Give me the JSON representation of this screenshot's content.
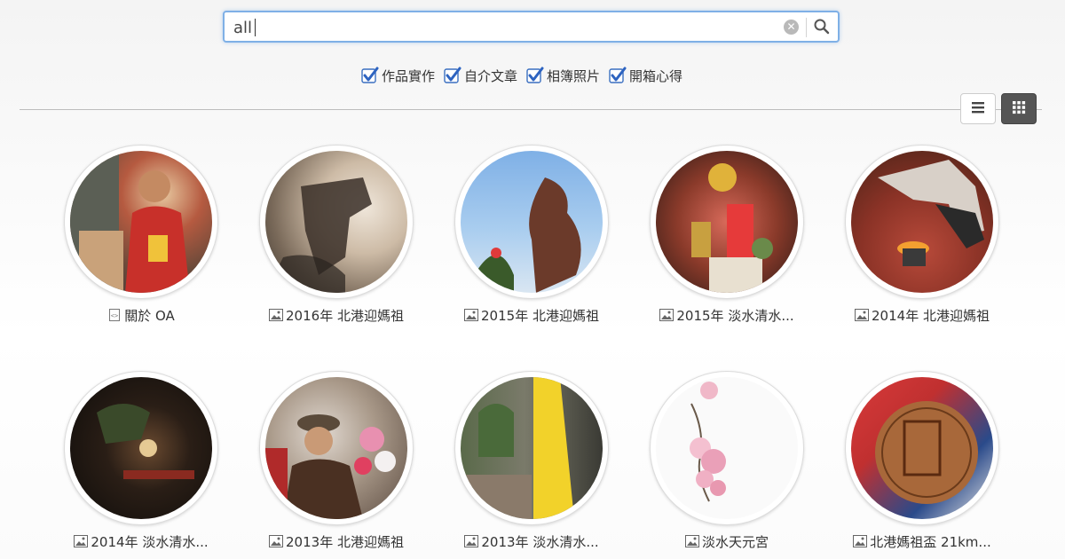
{
  "search": {
    "value": "all",
    "clear_icon": "clear-icon",
    "submit_icon": "search-icon"
  },
  "filters": [
    {
      "label": "作品實作",
      "checked": true
    },
    {
      "label": "自介文章",
      "checked": true
    },
    {
      "label": "相簿照片",
      "checked": true
    },
    {
      "label": "開箱心得",
      "checked": true
    }
  ],
  "view_toggle": {
    "list_icon": "list-view-icon",
    "grid_icon": "grid-view-icon",
    "active": "grid"
  },
  "items": [
    {
      "title": "關於 OA",
      "type": "article",
      "icon": "article-icon"
    },
    {
      "title": "2016年 北港迎媽祖",
      "type": "album",
      "icon": "image-icon"
    },
    {
      "title": "2015年 北港迎媽祖",
      "type": "album",
      "icon": "image-icon"
    },
    {
      "title": "2015年 淡水清水...",
      "type": "album",
      "icon": "image-icon"
    },
    {
      "title": "2014年 北港迎媽祖",
      "type": "album",
      "icon": "image-icon"
    },
    {
      "title": "2014年 淡水清水...",
      "type": "album",
      "icon": "image-icon"
    },
    {
      "title": "2013年 北港迎媽祖",
      "type": "album",
      "icon": "image-icon"
    },
    {
      "title": "2013年 淡水清水...",
      "type": "album",
      "icon": "image-icon"
    },
    {
      "title": "淡水天元宮",
      "type": "album",
      "icon": "image-icon"
    },
    {
      "title": "北港媽祖盃 21km...",
      "type": "album",
      "icon": "image-icon"
    }
  ]
}
